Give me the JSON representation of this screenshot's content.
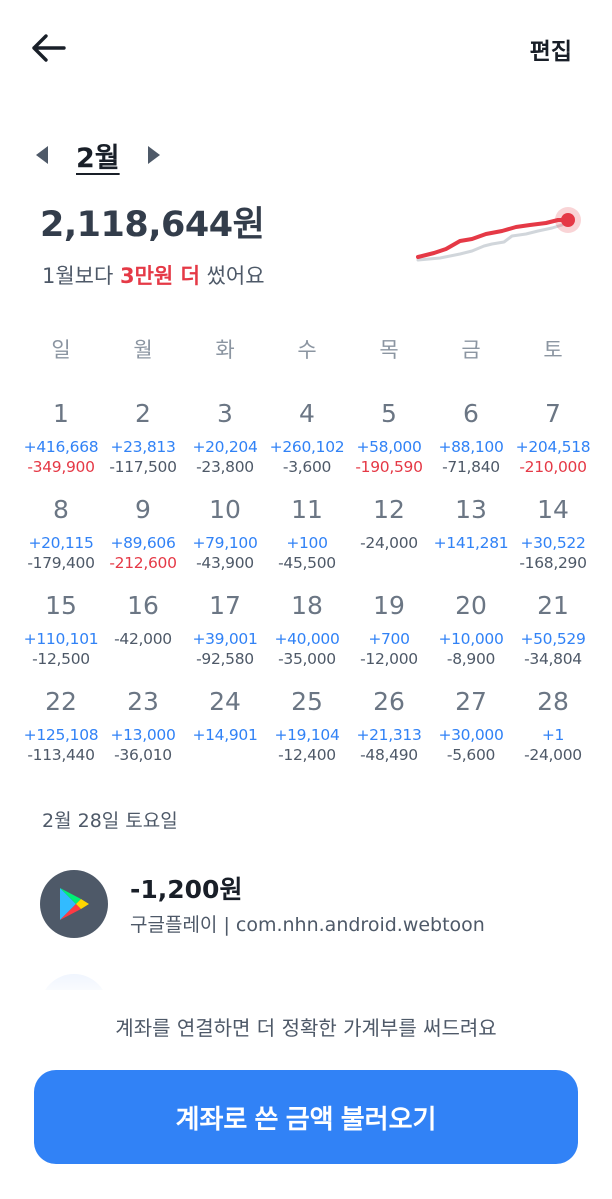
{
  "header": {
    "back_icon": "arrow-left-icon",
    "edit_label": "편집"
  },
  "month_nav": {
    "label": "2월",
    "prev_icon": "caret-left-icon",
    "next_icon": "caret-right-icon"
  },
  "summary": {
    "total": "2,118,644원",
    "compare_prefix": "1월보다 ",
    "compare_highlight": "3만원 더",
    "compare_suffix": " 썼어요"
  },
  "colors": {
    "accent": "#3182f6",
    "expense_red": "#e53946",
    "income_blue": "#3182f6",
    "trend_line": "#e53946",
    "prev_trend_line": "#d1d6db"
  },
  "weekdays": [
    "일",
    "월",
    "화",
    "수",
    "목",
    "금",
    "토"
  ],
  "calendar": [
    {
      "day": "1",
      "income": "+416,668",
      "expense": "-349,900",
      "expense_red": true
    },
    {
      "day": "2",
      "income": "+23,813",
      "expense": "-117,500",
      "expense_red": false
    },
    {
      "day": "3",
      "income": "+20,204",
      "expense": "-23,800",
      "expense_red": false
    },
    {
      "day": "4",
      "income": "+260,102",
      "expense": "-3,600",
      "expense_red": false
    },
    {
      "day": "5",
      "income": "+58,000",
      "expense": "-190,590",
      "expense_red": true
    },
    {
      "day": "6",
      "income": "+88,100",
      "expense": "-71,840",
      "expense_red": false
    },
    {
      "day": "7",
      "income": "+204,518",
      "expense": "-210,000",
      "expense_red": true
    },
    {
      "day": "8",
      "income": "+20,115",
      "expense": "-179,400",
      "expense_red": false
    },
    {
      "day": "9",
      "income": "+89,606",
      "expense": "-212,600",
      "expense_red": true
    },
    {
      "day": "10",
      "income": "+79,100",
      "expense": "-43,900",
      "expense_red": false
    },
    {
      "day": "11",
      "income": "+100",
      "expense": "-45,500",
      "expense_red": false
    },
    {
      "day": "12",
      "income": "",
      "expense": "-24,000",
      "expense_red": false
    },
    {
      "day": "13",
      "income": "+141,281",
      "expense": "",
      "expense_red": false
    },
    {
      "day": "14",
      "income": "+30,522",
      "expense": "-168,290",
      "expense_red": false
    },
    {
      "day": "15",
      "income": "+110,101",
      "expense": "-12,500",
      "expense_red": false
    },
    {
      "day": "16",
      "income": "",
      "expense": "-42,000",
      "expense_red": false
    },
    {
      "day": "17",
      "income": "+39,001",
      "expense": "-92,580",
      "expense_red": false
    },
    {
      "day": "18",
      "income": "+40,000",
      "expense": "-35,000",
      "expense_red": false
    },
    {
      "day": "19",
      "income": "+700",
      "expense": "-12,000",
      "expense_red": false
    },
    {
      "day": "20",
      "income": "+10,000",
      "expense": "-8,900",
      "expense_red": false
    },
    {
      "day": "21",
      "income": "+50,529",
      "expense": "-34,804",
      "expense_red": false
    },
    {
      "day": "22",
      "income": "+125,108",
      "expense": "-113,440",
      "expense_red": false
    },
    {
      "day": "23",
      "income": "+13,000",
      "expense": "-36,010",
      "expense_red": false
    },
    {
      "day": "24",
      "income": "+14,901",
      "expense": "",
      "expense_red": false
    },
    {
      "day": "25",
      "income": "+19,104",
      "expense": "-12,400",
      "expense_red": false
    },
    {
      "day": "26",
      "income": "+21,313",
      "expense": "-48,490",
      "expense_red": false
    },
    {
      "day": "27",
      "income": "+30,000",
      "expense": "-5,600",
      "expense_red": false
    },
    {
      "day": "28",
      "income": "+1",
      "expense": "-24,000",
      "expense_red": false
    }
  ],
  "selected_date": "2월 28일 토요일",
  "transaction": {
    "icon": "google-play-icon",
    "amount": "-1,200원",
    "merchant": "구글플레이",
    "separator": " | ",
    "detail": "com.nhn.android.webtoon"
  },
  "footer": {
    "notice": "계좌를 연결하면 더 정확한 가계부를 써드려요",
    "cta_label": "계좌로 쓴 금액 불러오기"
  }
}
